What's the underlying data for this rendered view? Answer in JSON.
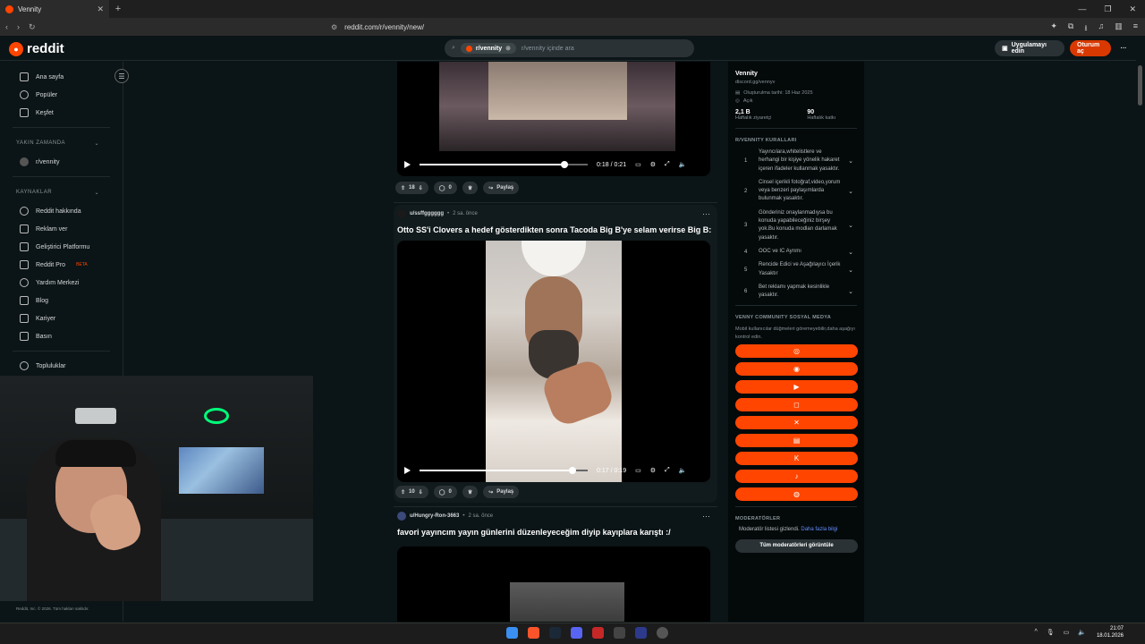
{
  "browser": {
    "tab_title": "Vennity",
    "url": "reddit.com/r/vennity/new/"
  },
  "header": {
    "logo_text": "reddit",
    "search_chip": "r/vennity",
    "search_placeholder": "r/vennity içinde ara",
    "get_app": "Uygulamayı edin",
    "login": "Oturum aç"
  },
  "sidebar": {
    "nav": [
      "Ana sayfa",
      "Popüler",
      "Keşfet"
    ],
    "recent_title": "YAKIN ZAMANDA",
    "recent_items": [
      "r/vennity"
    ],
    "resources_title": "KAYNAKLAR",
    "resources": [
      "Reddit hakkında",
      "Reklam ver",
      "Geliştirici Platformu",
      "Reddit Pro",
      "Yardım Merkezi",
      "Blog",
      "Kariyer",
      "Basın"
    ],
    "beta": "BETA",
    "communities": "Topluluklar",
    "footer": "Reddit, Inc. © 2026. Tüm hakları saklıdır."
  },
  "posts": [
    {
      "time": "0:18 / 0:21",
      "progress": 0.86,
      "votes": "18",
      "comments": "0",
      "share": "Paylaş"
    },
    {
      "user": "u/ssffgggggg",
      "age": "2 sa. önce",
      "title": "Otto SS'i Clovers a hedef gösterdikten sonra Tacoda Big B'ye selam verirse Big B:",
      "time": "0:17 / 0:19",
      "progress": 0.91,
      "votes": "10",
      "comments": "0",
      "share": "Paylaş"
    },
    {
      "user": "u/Hungry-Ron-3663",
      "age": "2 sa. önce",
      "title": "favori yayıncım yayın günlerini düzenleyeceğim diyip kayıplara karıştı :/"
    }
  ],
  "community": {
    "name": "Vennity",
    "link": "discord.gg/vennyv",
    "created": "Oluşturulma tarihi: 18 Haz 2025",
    "visibility": "Açık",
    "weekly_visitors": "2,1 B",
    "weekly_visitors_label": "Haftalık ziyaretçi",
    "weekly_contrib": "90",
    "weekly_contrib_label": "Haftalık katkı",
    "rules_title": "R/VENNITY KURALLARI",
    "rules": [
      {
        "n": "1",
        "t": "Yayıncılara,whitelistlere ve herhangi bir kişiye yönelik hakaret içeren ifadeler kullanmak yasaktır."
      },
      {
        "n": "2",
        "t": "Cinsel içerikli fotoğraf,video,yorum veya benzeri paylaşımlarda bulunmak yasaktır."
      },
      {
        "n": "3",
        "t": "Gönderiniz onaylanmadıysa bu konuda yapabileceğiniz birşey yok.Bu konuda modları darlamak yasaktır."
      },
      {
        "n": "4",
        "t": "OOC ve IC Ayrımı"
      },
      {
        "n": "5",
        "t": "Rencide Edici ve Aşağılayıcı İçerik Yasaktır"
      },
      {
        "n": "6",
        "t": "Bet reklamı yapmak kesinlikle yasaktır."
      }
    ],
    "social_title": "VENNY COMMUNITY SOSYAL MEDYA",
    "social_note": "Mobil kullanıcılar düğmeleri göremeyebilir,daha aşağıyı kontrol edin.",
    "social_buttons": [
      "globe-icon",
      "discord-icon",
      "youtube-icon",
      "instagram-icon",
      "x-icon",
      "twitch-icon",
      "kick-icon",
      "tiktok-icon",
      "steam-icon"
    ],
    "mods_title": "MODERATÖRLER",
    "mods_hidden": "Moderatör listesi gizlendi.",
    "mods_more": "Daha fazla bilgi",
    "mods_button": "Tüm moderatörleri görüntüle"
  },
  "taskbar": {
    "time": "21:07",
    "date": "18.01.2026"
  },
  "colors": {
    "accent": "#ff4500",
    "bg": "#0b1416"
  }
}
